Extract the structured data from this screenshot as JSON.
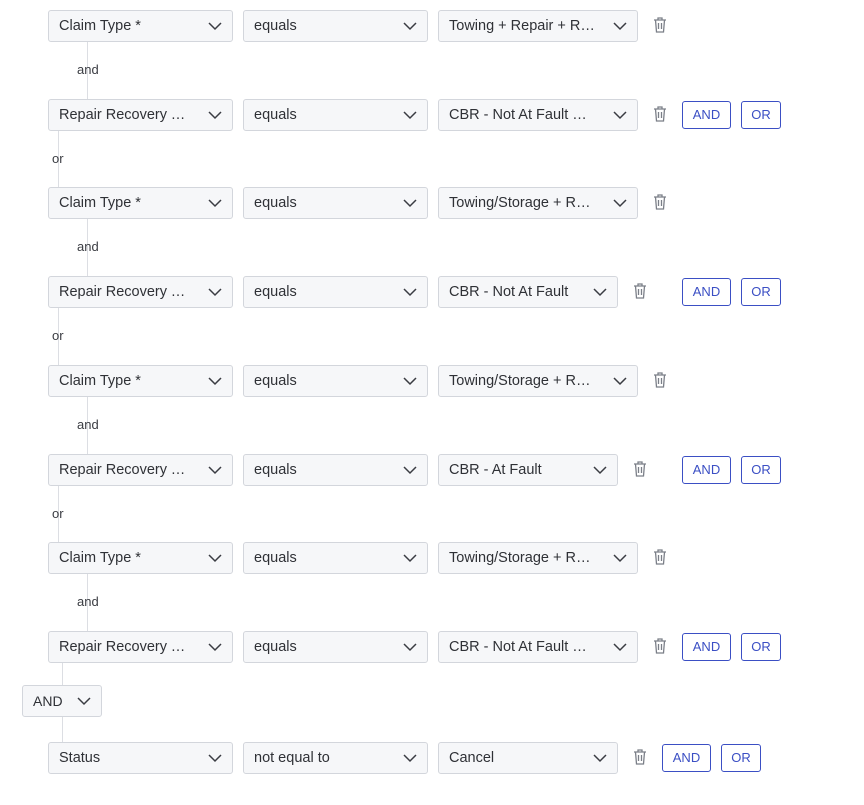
{
  "rows": [
    {
      "field": "Claim Type *",
      "op": "equals",
      "value": "Towing + Repair + Rental"
    },
    {
      "field": "Repair Recovery Type",
      "op": "equals",
      "value": "CBR - Not At Fault Direct"
    },
    {
      "field": "Claim Type *",
      "op": "equals",
      "value": "Towing/Storage + Repair"
    },
    {
      "field": "Repair Recovery Type",
      "op": "equals",
      "value": "CBR - Not At Fault"
    },
    {
      "field": "Claim Type *",
      "op": "equals",
      "value": "Towing/Storage + Repair"
    },
    {
      "field": "Repair Recovery Type",
      "op": "equals",
      "value": "CBR - At Fault"
    },
    {
      "field": "Claim Type *",
      "op": "equals",
      "value": "Towing/Storage + Repair"
    },
    {
      "field": "Repair Recovery Type",
      "op": "equals",
      "value": "CBR - Not At Fault Direct"
    },
    {
      "field": "Status",
      "op": "not equal to",
      "value": "Cancel"
    }
  ],
  "connectors": {
    "and": "and",
    "or": "or"
  },
  "buttons": {
    "and": "AND",
    "or": "OR"
  },
  "group_join": {
    "value": "AND"
  },
  "icons": {
    "delete": "trash-icon",
    "dropdown": "chevron-down-icon"
  },
  "colors": {
    "accent": "#3b4fc4",
    "field_bg": "#f6f7f9",
    "border": "#d3d6dc"
  }
}
